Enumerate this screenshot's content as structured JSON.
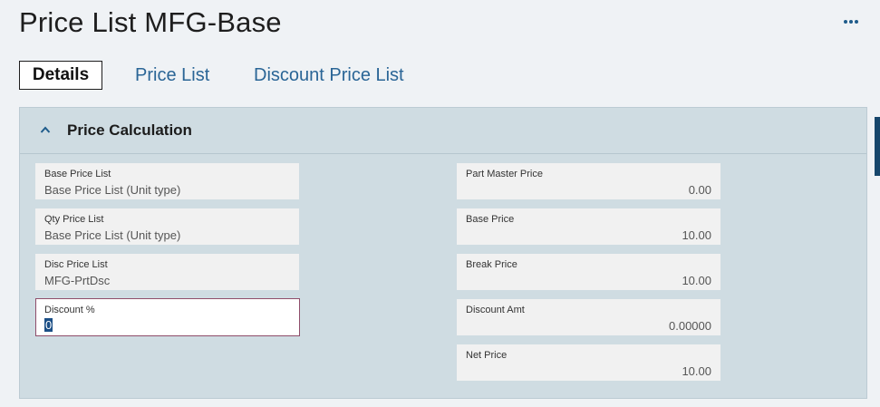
{
  "header": {
    "title": "Price List MFG-Base",
    "more_icon": "more-horizontal-icon"
  },
  "tabs": [
    {
      "label": "Details",
      "active": true
    },
    {
      "label": "Price List",
      "active": false
    },
    {
      "label": "Discount Price List",
      "active": false
    }
  ],
  "panel": {
    "title": "Price Calculation",
    "collapse_icon": "chevron-up-icon",
    "left_fields": [
      {
        "label": "Base Price List",
        "value": "Base Price List (Unit type)"
      },
      {
        "label": "Qty Price List",
        "value": "Base Price List (Unit type)"
      },
      {
        "label": "Disc Price List",
        "value": "MFG-PrtDsc"
      },
      {
        "label": "Discount %",
        "value": "0",
        "editable": true
      }
    ],
    "right_fields": [
      {
        "label": "Part Master Price",
        "value": "0.00"
      },
      {
        "label": "Base Price",
        "value": "10.00"
      },
      {
        "label": "Break Price",
        "value": "10.00"
      },
      {
        "label": "Discount Amt",
        "value": "0.00000"
      },
      {
        "label": "Net Price",
        "value": "10.00"
      }
    ]
  },
  "colors": {
    "accent": "#2a6596",
    "panel_bg": "#cfdce2",
    "active_border": "#8f4d6a"
  }
}
